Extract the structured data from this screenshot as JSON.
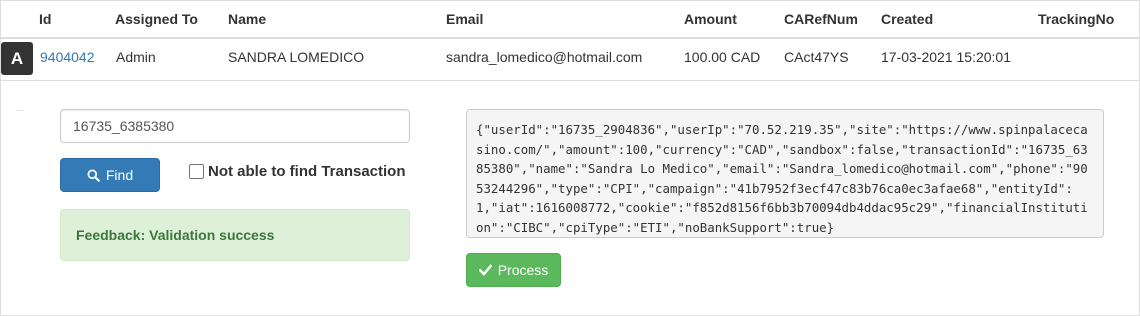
{
  "table": {
    "headers": {
      "id": "Id",
      "assigned_to": "Assigned To",
      "name": "Name",
      "email": "Email",
      "amount": "Amount",
      "carefnum": "CARefNum",
      "created": "Created",
      "trackingno": "TrackingNo"
    },
    "row": {
      "avatar": "A",
      "id": "9404042",
      "assigned_to": "Admin",
      "name": "SANDRA LOMEDICO",
      "email": "sandra_lomedico@hotmail.com",
      "amount": "100.00 CAD",
      "carefnum": "CAct47YS",
      "created": "17-03-2021 15:20:01",
      "trackingno": ""
    }
  },
  "search": {
    "value": "16735_6385380",
    "find_label": "Find",
    "find_icon": "search-icon"
  },
  "checkbox": {
    "label": "Not able to find Transaction",
    "checked": false
  },
  "feedback": {
    "text": "Feedback: Validation success"
  },
  "json_output": "{\"userId\":\"16735_2904836\",\"userIp\":\"70.52.219.35\",\"site\":\"https://www.spinpalacecasino.com/\",\"amount\":100,\"currency\":\"CAD\",\"sandbox\":false,\"transactionId\":\"16735_6385380\",\"name\":\"Sandra Lo Medico\",\"email\":\"Sandra_lomedico@hotmail.com\",\"phone\":\"9053244296\",\"type\":\"CPI\",\"campaign\":\"41b7952f3ecf47c83b76ca0ec3afae68\",\"entityId\":1,\"iat\":1616008772,\"cookie\":\"f852d8156f6bb3b70094db4ddac95c29\",\"financialInstitution\":\"CIBC\",\"cpiType\":\"ETI\",\"noBankSupport\":true}",
  "process": {
    "label": "Process",
    "icon": "check-icon"
  },
  "colors": {
    "link": "#337ab7",
    "primary": "#337ab7",
    "success": "#5cb85c",
    "alert_bg": "#dff0d8",
    "alert_text": "#3c763d",
    "avatar_bg": "#333333"
  }
}
